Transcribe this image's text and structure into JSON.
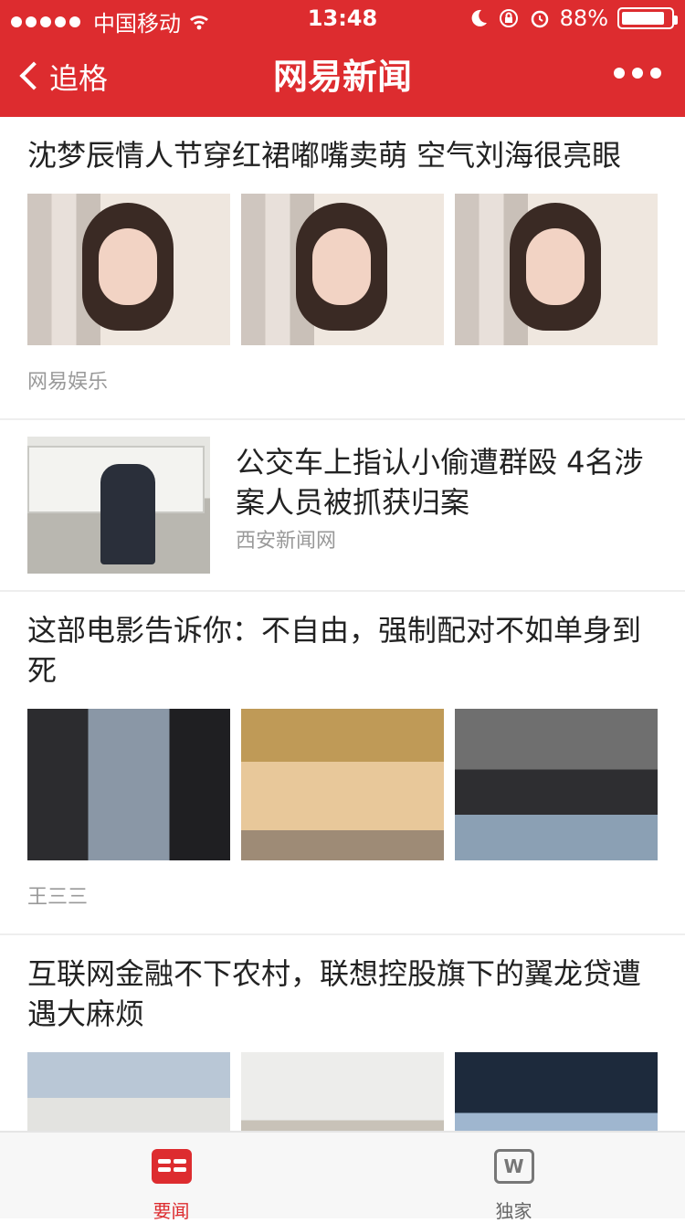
{
  "status_bar": {
    "carrier": "中国移动",
    "time": "13:48",
    "battery": "88%"
  },
  "nav": {
    "back_label": "追格",
    "title": "网易新闻"
  },
  "feed": {
    "items": [
      {
        "title": "沈梦辰情人节穿红裙嘟嘴卖萌 空气刘海很亮眼",
        "source": "网易娱乐"
      },
      {
        "title": "公交车上指认小偷遭群殴 4名涉案人员被抓获归案",
        "source": "西安新闻网"
      },
      {
        "title": "这部电影告诉你：不自由，强制配对不如单身到死",
        "source": "王三三"
      },
      {
        "title": "互联网金融不下农村，联想控股旗下的翼龙贷遭遇大麻烦",
        "source": ""
      }
    ]
  },
  "tabbar": {
    "tabs": [
      {
        "label": "要闻",
        "icon": "news-icon",
        "active": true
      },
      {
        "label": "独家",
        "icon": "bookmark-icon",
        "active": false
      }
    ],
    "accent": "#dd2c2f"
  }
}
